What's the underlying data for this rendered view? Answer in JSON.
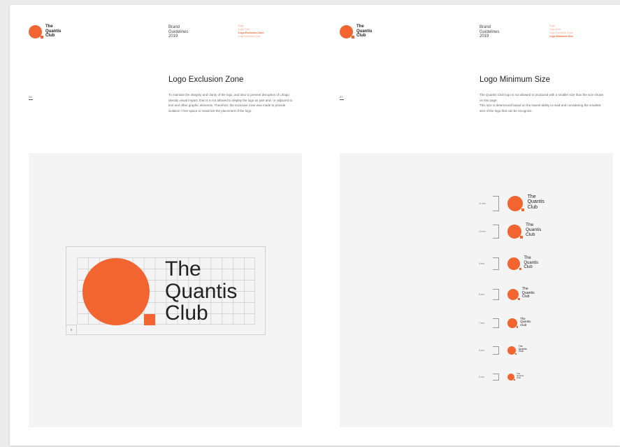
{
  "logo": {
    "word": "The\nQuantis\nClub"
  },
  "brand_info": "Brand\nGuidelines\n2019",
  "nav": [
    "Logo",
    "Logo Grid",
    "Logo Exclusion Zone",
    "Logo Minimum Size"
  ],
  "left": {
    "page_number": "26",
    "nav_active_index": 2,
    "title": "Logo Exclusion Zone",
    "body": "To maintain the integrity and clarity of the logo, and also to prevent disruption of Lihago identity visual impact, then it is not allowed to display the logo as part and / or adjacent to text and other graphic elements. Therefore, the exclusive zone was made to provide isolation / free space to maximize the placement of the logo.",
    "x_marker": "x",
    "logo_word": "The\nQuantis\nClub"
  },
  "right": {
    "page_number": "27",
    "nav_active_index": 3,
    "title": "Logo Minimum Size",
    "body": "The Quantis Club logo is not allowed to produced with a smaller size than the size shown on this page.\nThis size is determined based on the lowest ability to read and considering the smallest size of the logo that can be recognize.",
    "sizes": [
      {
        "label": "11 mm",
        "word": "The\nQuantis\nClub"
      },
      {
        "label": "10 mm",
        "word": "The\nQuantis\nClub"
      },
      {
        "label": "9 mm",
        "word": "The\nQuantis\nClub"
      },
      {
        "label": "8 mm",
        "word": "The\nQuantis\nClub"
      },
      {
        "label": "7 mm",
        "word": "The\nQuantis\nClub"
      },
      {
        "label": "6 mm",
        "word": "The\nQuantis\nClub"
      },
      {
        "label": "5 mm",
        "word": "The\nQuantis\nClub"
      }
    ]
  },
  "colors": {
    "brand_orange": "#f26430",
    "panel_bg": "#f4f4f4"
  }
}
